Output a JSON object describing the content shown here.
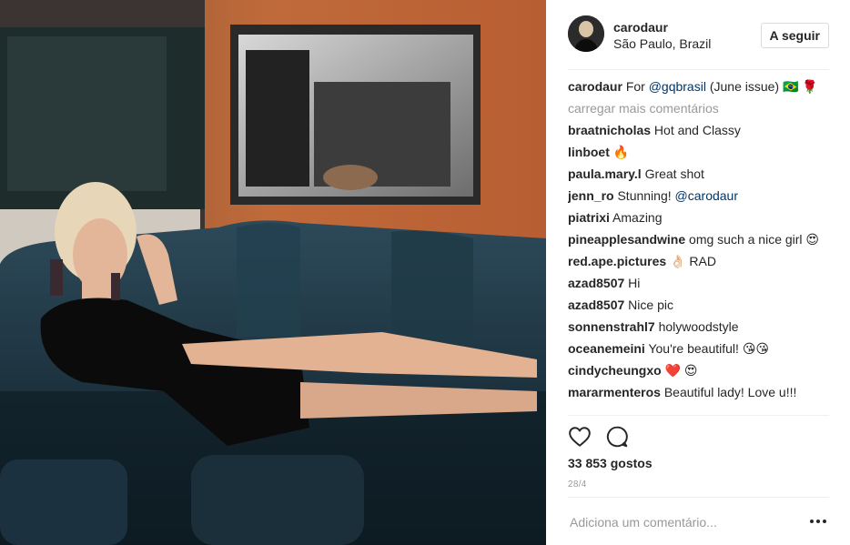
{
  "post": {
    "username": "carodaur",
    "location": "São Paulo, Brazil",
    "follow_label": "A seguir",
    "caption": {
      "user": "carodaur",
      "text_before": "For ",
      "mention": "@gqbrasil",
      "text_after": " (June issue) 🇧🇷 🌹"
    },
    "load_more": "carregar mais comentários",
    "comments": [
      {
        "user": "braatnicholas",
        "text": "Hot and Classy"
      },
      {
        "user": "linboet",
        "text": "🔥"
      },
      {
        "user": "paula.mary.l",
        "text": "Great shot"
      },
      {
        "user": "jenn_ro",
        "text": "Stunning!",
        "mention": "@carodaur"
      },
      {
        "user": "piatrixi",
        "text": "Amazing"
      },
      {
        "user": "pineapplesandwine",
        "text": "omg such a nice girl 😍"
      },
      {
        "user": "red.ape.pictures",
        "text": "👌🏻 RAD"
      },
      {
        "user": "azad8507",
        "text": "Hi"
      },
      {
        "user": "azad8507",
        "text": "Nice pic"
      },
      {
        "user": "sonnenstrahl7",
        "text": "holywoodstyle"
      },
      {
        "user": "oceanemeini",
        "text": "You're beautiful! 😘😘"
      },
      {
        "user": "cindycheungxo",
        "text": "❤️ 😍"
      },
      {
        "user": "mararmenteros",
        "text": "Beautiful lady! Love u!!!"
      }
    ],
    "likes": "33 853 gostos",
    "date": "28/4",
    "comment_placeholder": "Adiciona um comentário...",
    "icons": {
      "like": "heart-icon",
      "comment": "speech-bubble-icon",
      "options": "more-options-icon"
    }
  },
  "colors": {
    "text": "#262626",
    "muted": "#999999",
    "mention": "#003569",
    "border": "#efefef"
  }
}
